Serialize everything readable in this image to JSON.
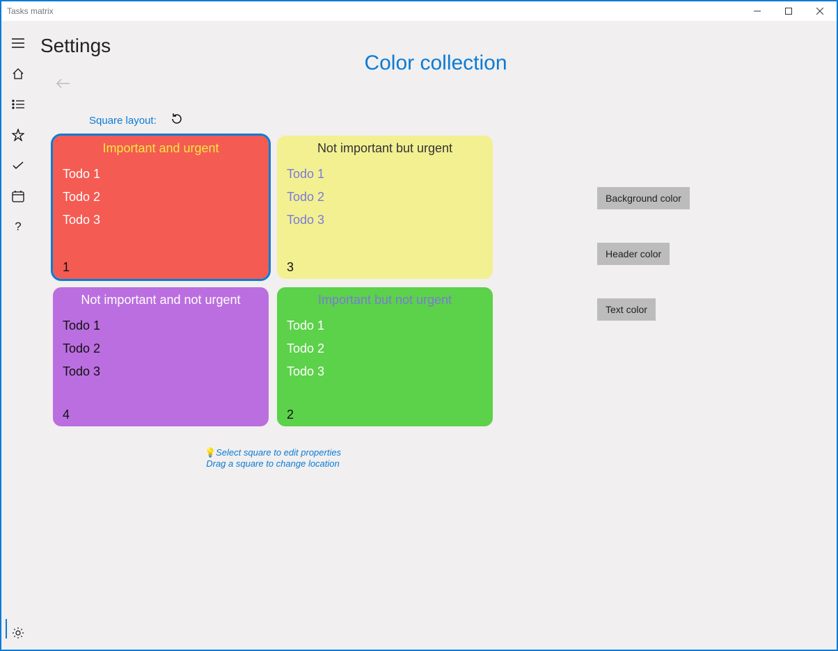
{
  "window": {
    "title": "Tasks matrix"
  },
  "page": {
    "header": "Settings",
    "title": "Color collection",
    "layout_label": "Square layout:"
  },
  "squares": [
    {
      "title": "Important and urgent",
      "items": [
        "Todo 1",
        "Todo 2",
        "Todo 3"
      ],
      "number": "1",
      "bg": "#f45b52",
      "title_color": "#f5e742",
      "text_color": "#ffffff",
      "selected": true
    },
    {
      "title": "Not important but urgent",
      "items": [
        "Todo 1",
        "Todo 2",
        "Todo 3"
      ],
      "number": "3",
      "bg": "#f3f092",
      "title_color": "#333333",
      "text_color": "#7a7ad9",
      "selected": false
    },
    {
      "title": "Not important and not urgent",
      "items": [
        "Todo 1",
        "Todo 2",
        "Todo 3"
      ],
      "number": "4",
      "bg": "#bb6ee0",
      "title_color": "#ffffff",
      "text_color": "#111111",
      "selected": false
    },
    {
      "title": "Important but not urgent",
      "items": [
        "Todo 1",
        "Todo 2",
        "Todo 3"
      ],
      "number": "2",
      "bg": "#5cd14a",
      "title_color": "#7a7ad9",
      "text_color": "#ffffff",
      "selected": false
    }
  ],
  "side": {
    "bg_btn": "Background color",
    "header_btn": "Header color",
    "text_btn": "Text color"
  },
  "hints": {
    "l1": "Select square to edit properties",
    "l2": "Drag a square to change location"
  }
}
